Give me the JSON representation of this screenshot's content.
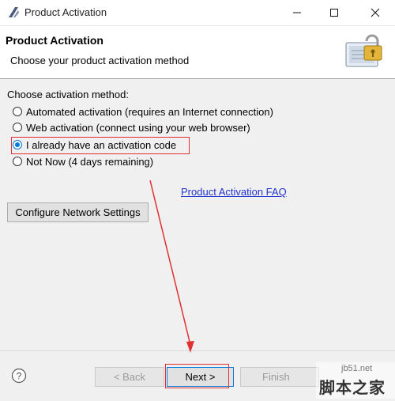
{
  "window": {
    "title": "Product Activation"
  },
  "header": {
    "title": "Product Activation",
    "subtitle": "Choose your product activation method"
  },
  "content": {
    "method_label": "Choose activation method:",
    "options": [
      {
        "label": "Automated activation (requires an Internet connection)",
        "selected": false
      },
      {
        "label": "Web activation (connect using your web browser)",
        "selected": false
      },
      {
        "label": "I already have an activation code",
        "selected": true
      },
      {
        "label": "Not Now (4 days remaining)",
        "selected": false
      }
    ],
    "faq_link": "Product Activation FAQ",
    "network_button": "Configure Network Settings"
  },
  "footer": {
    "back": "< Back",
    "next": "Next >",
    "finish": "Finish"
  },
  "watermark": {
    "url": "jb51.net",
    "name": "脚本之家"
  },
  "colors": {
    "accent": "#0078d7",
    "annotation": "#e03030",
    "link": "#2233cc"
  }
}
